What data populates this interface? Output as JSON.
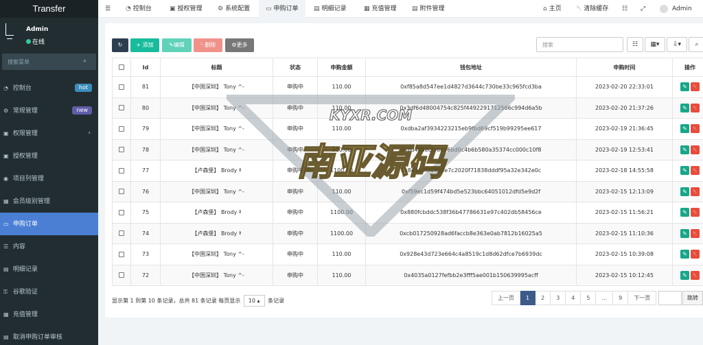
{
  "app": {
    "title": "Transfer"
  },
  "user": {
    "name": "Admin",
    "status": "在线"
  },
  "sidebar": {
    "search_placeholder": "搜索菜单",
    "items": [
      {
        "label": "控制台",
        "badge": "hot",
        "icon": "dashboard-icon"
      },
      {
        "label": "常规管理",
        "badge": "new",
        "icon": "cogs-icon"
      },
      {
        "label": "权限管理",
        "icon": "group-icon"
      },
      {
        "label": "授权管理",
        "icon": "users-icon"
      },
      {
        "label": "项目列管理",
        "icon": "circle-icon"
      },
      {
        "label": "会员级别管理",
        "icon": "calendar-icon"
      },
      {
        "label": "申购订单",
        "icon": "credit-card-icon"
      },
      {
        "label": "内容",
        "icon": "list-icon"
      },
      {
        "label": "明细记录",
        "icon": "file-icon"
      },
      {
        "label": "谷歌验证",
        "icon": "key-icon"
      },
      {
        "label": "充值管理",
        "icon": "calendar-icon"
      },
      {
        "label": "取消申购订单审核",
        "icon": "file-icon"
      }
    ]
  },
  "topbar": {
    "tabs": [
      "控制台",
      "授权管理",
      "系统配置",
      "申购订单",
      "明细记录",
      "充值管理",
      "附件管理"
    ],
    "home": "主页",
    "clear_cache": "清除缓存",
    "admin": "Admin"
  },
  "toolbar": {
    "add": "添加",
    "edit": "编辑",
    "delete": "删除",
    "more": "更多",
    "search_placeholder": "搜索"
  },
  "table": {
    "headers": [
      "Id",
      "标题",
      "状态",
      "申购金额",
      "钱包地址",
      "申购时间",
      "操作"
    ],
    "rows": [
      {
        "id": "81",
        "title": "【中国深圳】 Tony ^-",
        "status": "申购中",
        "amount": "110.00",
        "wallet": "0xf85a8d547ee1d4827d3644c730be33c965fcd3ba",
        "time": "2023-02-20 22:33:01"
      },
      {
        "id": "80",
        "title": "【中国深圳】 Tony ^-",
        "status": "申购中",
        "amount": "110.00",
        "wallet": "0x3df6d48004754c825f4492291712566c994d6a5b",
        "time": "2023-02-20 21:37:26"
      },
      {
        "id": "79",
        "title": "【中国深圳】 Tony ^-",
        "status": "申购中",
        "amount": "110.00",
        "wallet": "0xdba2af3934223215eb9fbd69cf519b99295ee617",
        "time": "2023-02-19 21:36:45"
      },
      {
        "id": "78",
        "title": "【中国深圳】 Tony ^-",
        "status": "申购中",
        "amount": "500.00",
        "wallet": "0x6d488ecf36876bd0c4b6b580a35374cc000c10f8",
        "time": "2023-02-19 12:53:41"
      },
      {
        "id": "77",
        "title": "【卢森堡】 Brody ª",
        "status": "申购中",
        "amount": "1100.00",
        "wallet": "0x8411df06484e7c2020f71838dddf95a32e342e0c",
        "time": "2023-02-18 14:55:58"
      },
      {
        "id": "76",
        "title": "【中国深圳】 Tony ^-",
        "status": "申购中",
        "amount": "110.00",
        "wallet": "0xf59ec1d59f474bd5e523bbc64051012dfd5e9d2f",
        "time": "2023-02-15 12:13:09"
      },
      {
        "id": "75",
        "title": "【卢森堡】 Brody ª",
        "status": "申购中",
        "amount": "1100.00",
        "wallet": "0x880fcbddc538f36b47786631e97c402db58456ce",
        "time": "2023-02-15 11:56:21"
      },
      {
        "id": "74",
        "title": "【卢森堡】 Brody ª",
        "status": "申购中",
        "amount": "1100.00",
        "wallet": "0xcb017250928ad6faccb8e363e0ab7812b16025a5",
        "time": "2023-02-15 11:10:36"
      },
      {
        "id": "73",
        "title": "【中国深圳】 Tony ^-",
        "status": "申购中",
        "amount": "110.00",
        "wallet": "0x928e43d723e664c4a8519c1d8d62dfce7b6939dc",
        "time": "2023-02-15 10:39:08"
      },
      {
        "id": "72",
        "title": "【中国深圳】 Tony ^-",
        "status": "申购中",
        "amount": "110.00",
        "wallet": "0x4035a0127fefbb2e3fff5ae001b150639995acff",
        "time": "2023-02-15 10:12:45"
      }
    ]
  },
  "footer": {
    "info": "显示第 1 到第 10 条记录，总共 81 条记录 每页显示",
    "per_page": "10",
    "suffix": "条记录"
  },
  "pagination": {
    "prev": "上一页",
    "pages": [
      "1",
      "2",
      "3",
      "4",
      "5",
      "...",
      "9"
    ],
    "next": "下一页",
    "jump": "跳转"
  },
  "watermark": {
    "text": "南亚源码",
    "sub": "KYXR.COM"
  },
  "colors": {
    "sidebar_bg": "#222d32",
    "active": "#4a7fd4",
    "add": "#18bc9c",
    "edit": "#5fd2b8",
    "delete": "#f0928a",
    "more": "#777777"
  }
}
